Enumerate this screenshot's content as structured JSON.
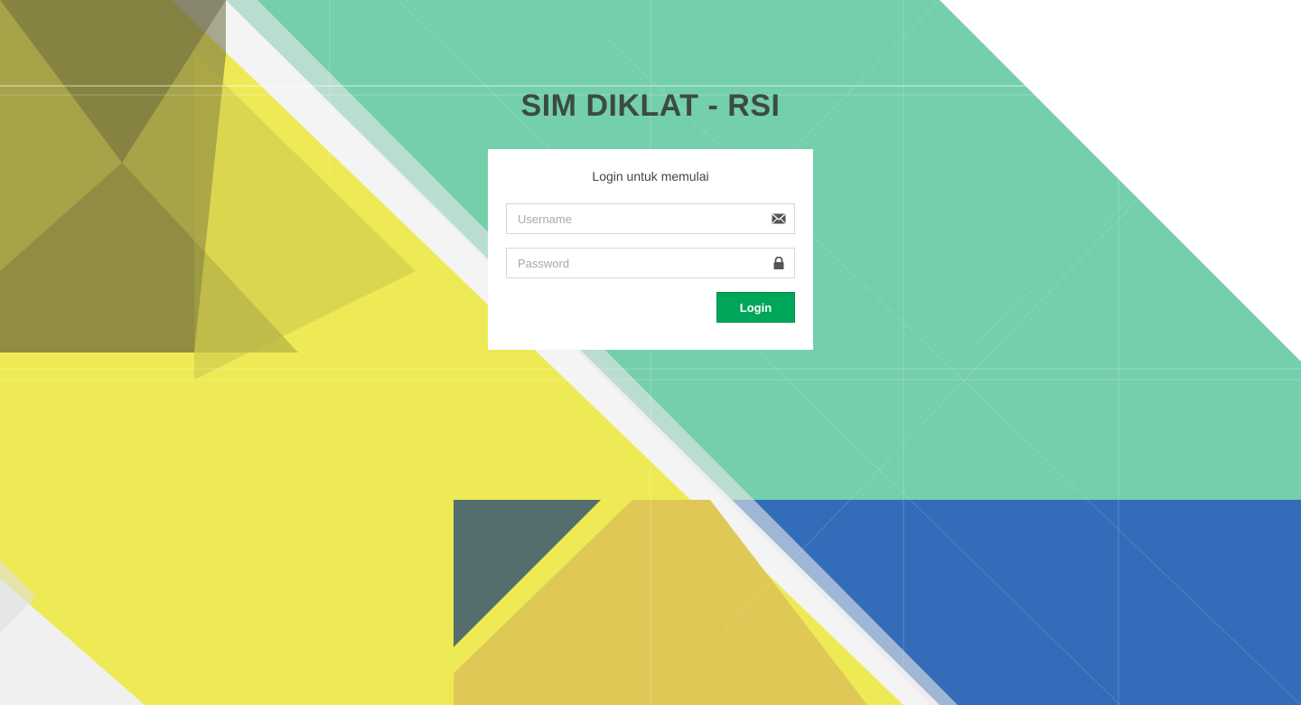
{
  "app": {
    "title": "SIM DIKLAT - RSI"
  },
  "login_box": {
    "message": "Login untuk memulai",
    "username": {
      "placeholder": "Username",
      "value": "",
      "icon": "envelope-icon"
    },
    "password": {
      "placeholder": "Password",
      "value": "",
      "icon": "lock-icon"
    },
    "submit_label": "Login"
  },
  "colors": {
    "background_green": "#74cfab",
    "background_yellow": "#eeea55",
    "background_blue": "#336cb9",
    "button_green": "#00a65a",
    "title_text": "#3d4a45"
  }
}
